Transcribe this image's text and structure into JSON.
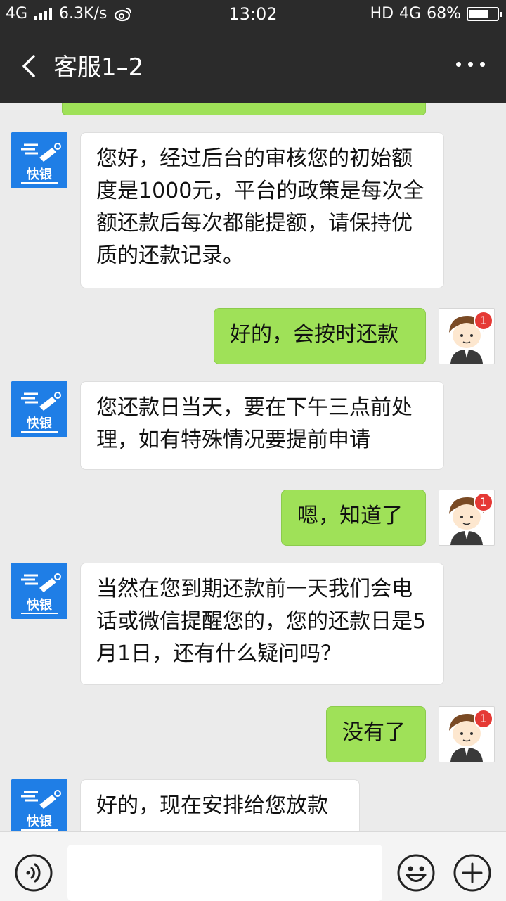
{
  "status_bar": {
    "network_left": "4G",
    "speed": "6.3K/s",
    "time": "13:02",
    "hd": "HD",
    "network_right": "4G",
    "battery": "68%",
    "battery_level": 0.68
  },
  "header": {
    "back_icon": "chevron-left-icon",
    "title": "客服1–2",
    "more_icon": "more-dots-icon"
  },
  "chat": {
    "messages": [
      {
        "side": "left",
        "text": "您好，经过后台的审核您的初始额度是1000元，平台的政策是每次全额还款后每次都能提额，请保持优质的还款记录。"
      },
      {
        "side": "right",
        "text": "好的，会按时还款",
        "badge": "1"
      },
      {
        "side": "left",
        "text": "您还款日当天，要在下午三点前处理，如有特殊情况要提前申请"
      },
      {
        "side": "right",
        "text": "嗯，知道了",
        "badge": "1"
      },
      {
        "side": "left",
        "text": "当然在您到期还款前一天我们会电话或微信提醒您的，您的还款日是5月1日，还有什么疑问吗？"
      },
      {
        "side": "right",
        "text": "没有了",
        "badge": "1"
      },
      {
        "side": "left",
        "text": "好的，现在安排给您放款"
      }
    ],
    "cs_avatar_text": "快银",
    "colors": {
      "self_bubble": "#9fe158",
      "cs_avatar": "#1f7ee6",
      "bar": "#2b2b2b"
    }
  },
  "input_bar": {
    "voice_icon": "voice-icon",
    "text_value": "",
    "emoji_icon": "emoji-icon",
    "plus_icon": "plus-icon"
  }
}
